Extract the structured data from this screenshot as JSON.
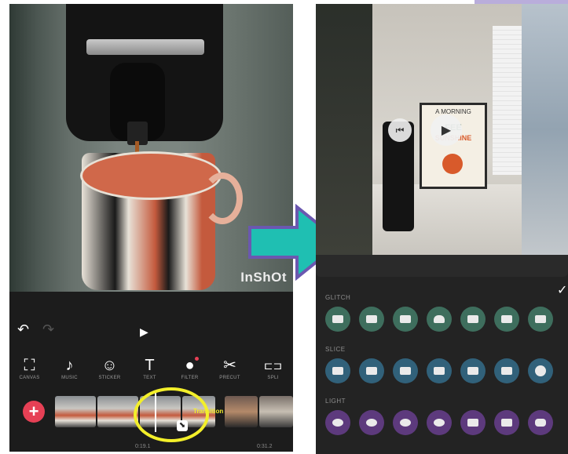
{
  "left_phone": {
    "watermark": "InShOt",
    "toolbar": [
      {
        "icon": "canvas-icon",
        "glyph": "⛶",
        "label": "CANVAS"
      },
      {
        "icon": "music-icon",
        "glyph": "♪",
        "label": "MUSIC"
      },
      {
        "icon": "sticker-icon",
        "glyph": "☺",
        "label": "STICKER"
      },
      {
        "icon": "text-icon",
        "glyph": "T",
        "label": "TEXT"
      },
      {
        "icon": "filter-icon",
        "glyph": "●",
        "label": "FILTER"
      },
      {
        "icon": "precut-icon",
        "glyph": "✂",
        "label": "PRECUT"
      },
      {
        "icon": "split-icon",
        "glyph": "⊏⊐",
        "label": "SPLI"
      }
    ],
    "transition_label": "Transition",
    "time_current": "0:19.1",
    "time_total": "0:31.2",
    "add_button": "+",
    "undo_icon": "↶",
    "play_icon": "▶"
  },
  "right_phone": {
    "prev_icon": "previous-icon",
    "play_icon": "play-icon",
    "poster_lines": [
      "A MORNING",
      "FEE",
      "SUNSHINE"
    ],
    "confirm": "✓",
    "categories": [
      {
        "label": "GLITCH",
        "count": 7,
        "color": "#3e6e5d"
      },
      {
        "label": "SLICE",
        "count": 7,
        "color": "#31617a"
      },
      {
        "label": "LIGHT",
        "count": 7,
        "color": "#5d3a7d"
      }
    ]
  },
  "colors": {
    "arrow_fill": "#1fbfb2",
    "arrow_outline": "#6b58b0",
    "highlight_ring": "#f3ef2a",
    "add_button": "#e64055",
    "top_badge": "#b9addb"
  }
}
